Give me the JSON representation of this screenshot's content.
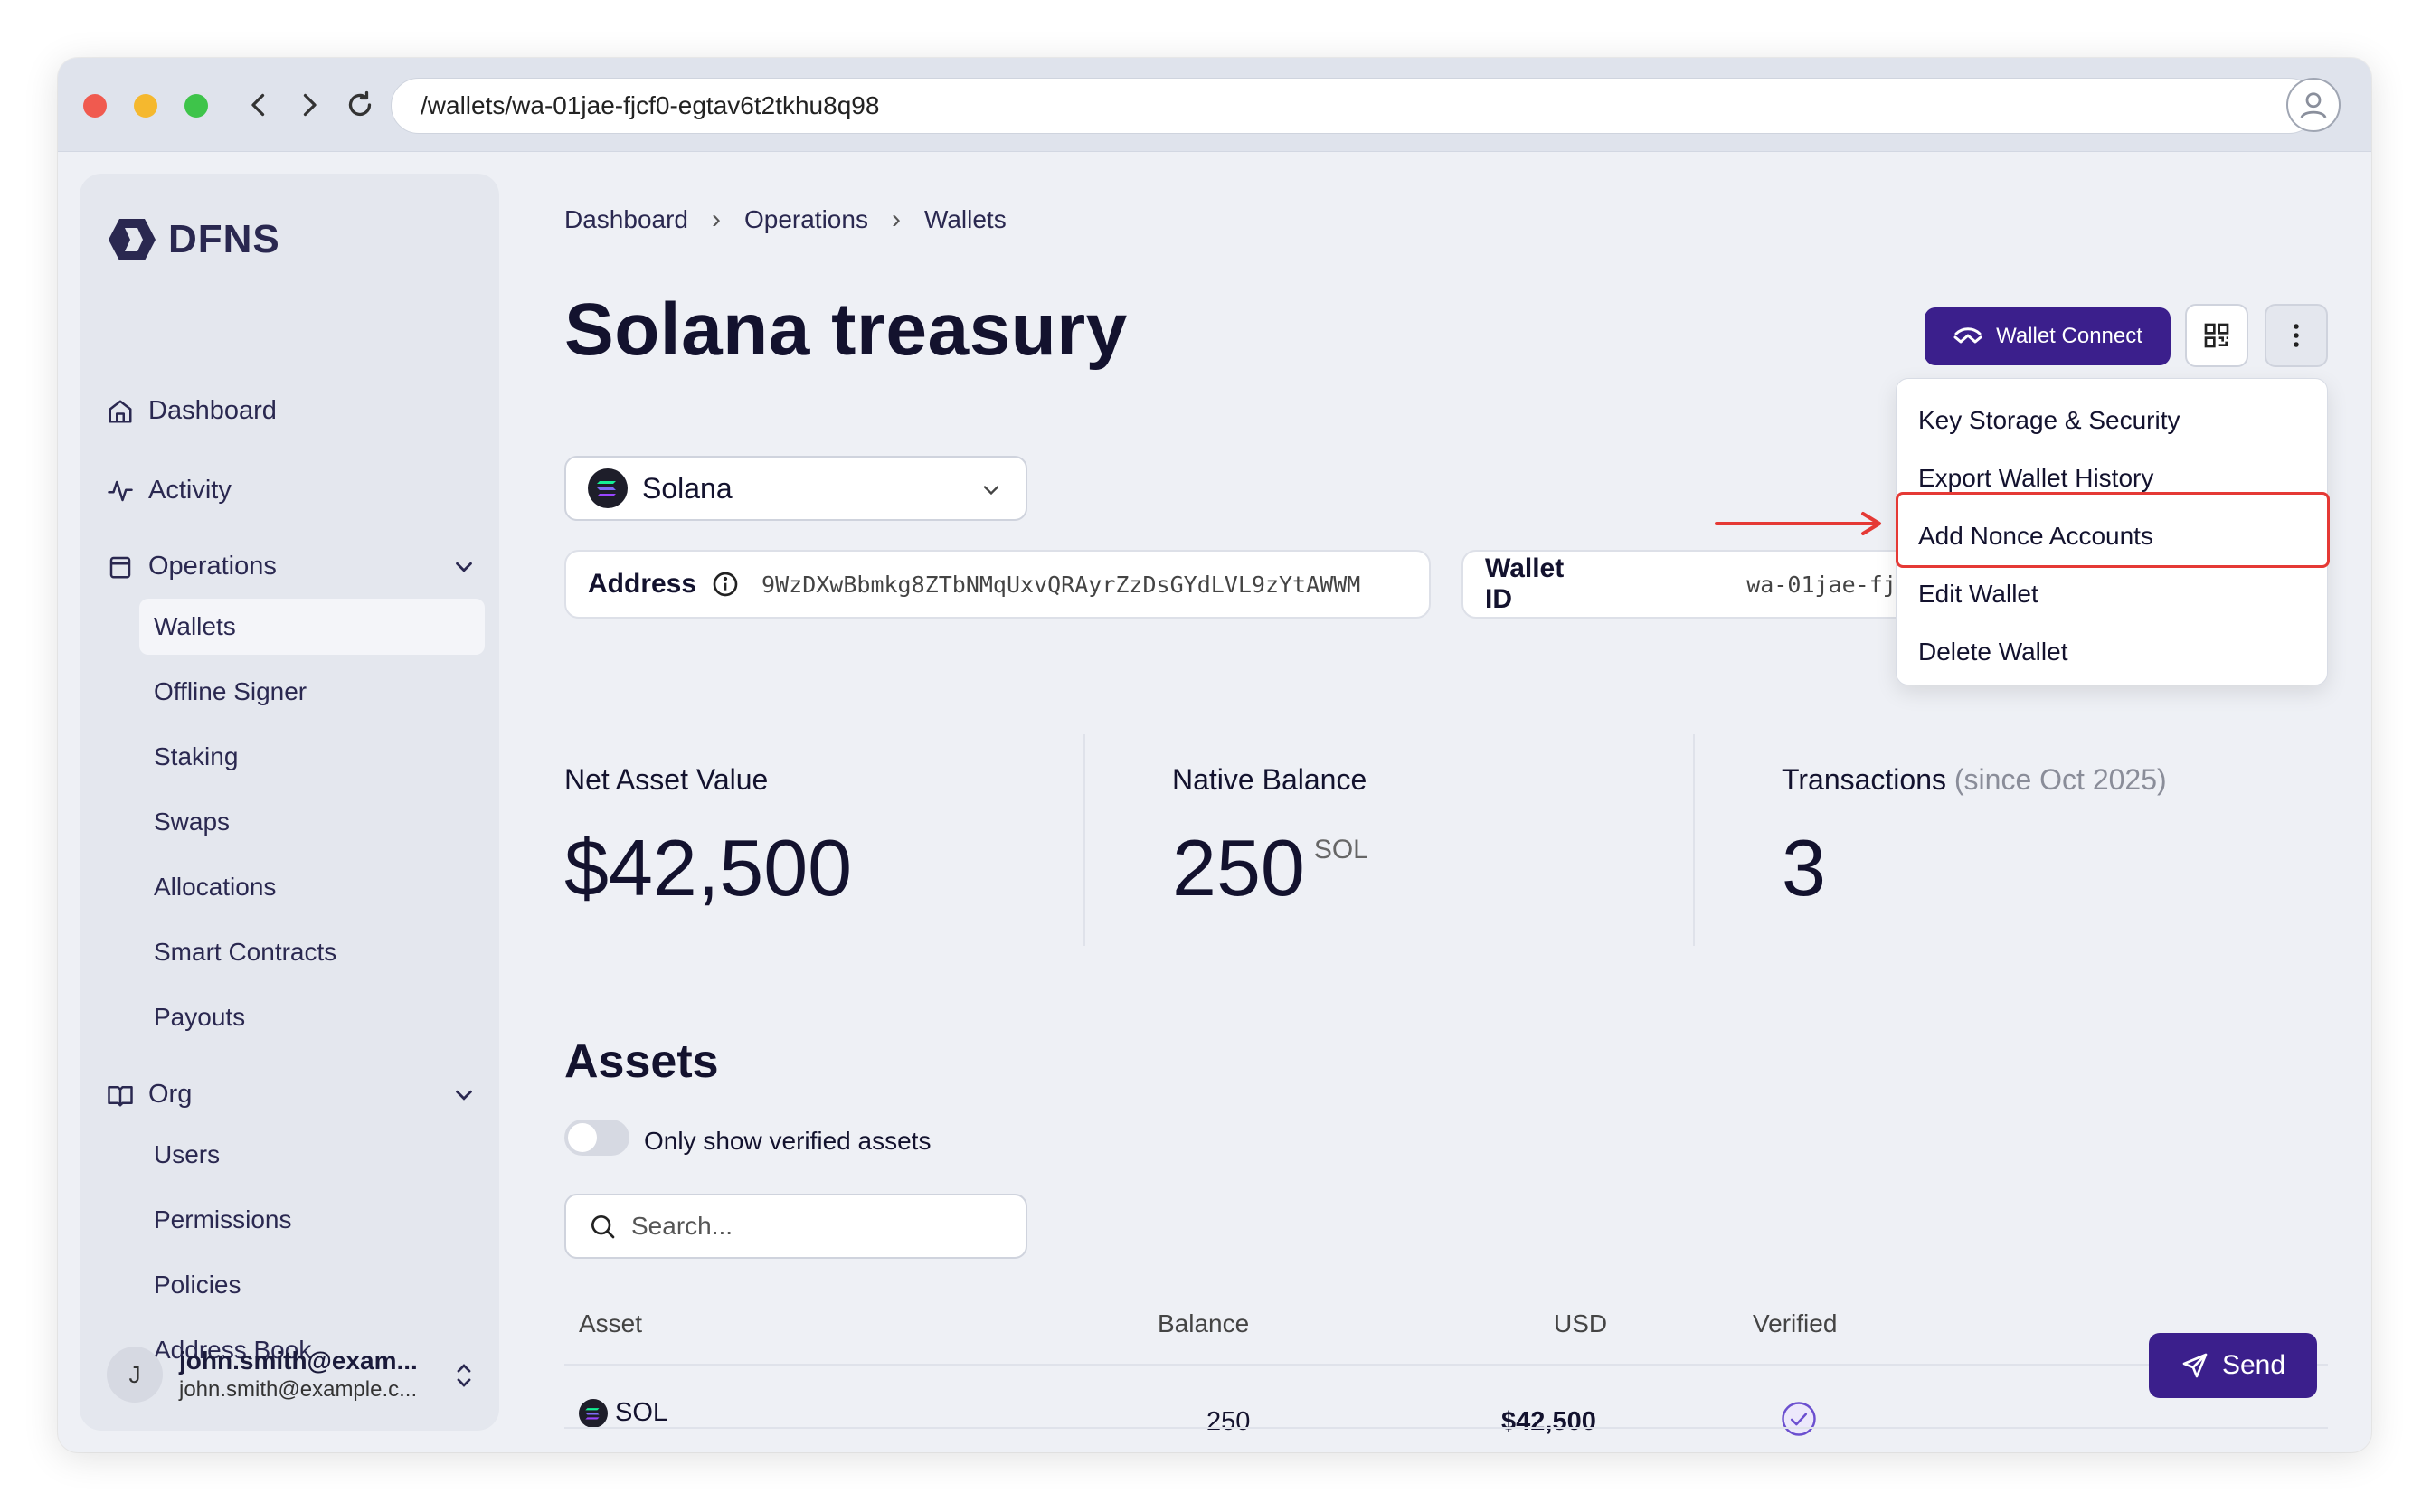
{
  "browser": {
    "url": "/wallets/wa-01jae-fjcf0-egtav6t2tkhu8q98"
  },
  "sidebar": {
    "logo": "DFNS",
    "items": [
      {
        "label": "Dashboard",
        "icon": "home-icon"
      },
      {
        "label": "Activity",
        "icon": "activity-icon"
      },
      {
        "label": "Operations",
        "icon": "clipboard-icon"
      },
      {
        "label": "Org",
        "icon": "book-icon"
      }
    ],
    "operations_sub": [
      "Wallets",
      "Offline Signer",
      "Staking",
      "Swaps",
      "Allocations",
      "Smart Contracts",
      "Payouts"
    ],
    "org_sub": [
      "Users",
      "Permissions",
      "Policies",
      "Address Book"
    ],
    "user": {
      "initial": "J",
      "name": "john.smith@exam...",
      "email": "john.smith@example.c..."
    }
  },
  "breadcrumb": [
    "Dashboard",
    "Operations",
    "Wallets"
  ],
  "page_title": "Solana treasury",
  "header_actions": {
    "wallet_connect_label": "Wallet Connect"
  },
  "menu": {
    "items": [
      "Key Storage & Security",
      "Export Wallet History",
      "Add Nonce Accounts",
      "Edit Wallet",
      "Delete Wallet"
    ],
    "highlighted": "Add Nonce Accounts"
  },
  "network_select": {
    "value": "Solana"
  },
  "address": {
    "label": "Address",
    "value": "9WzDXwBbmkg8ZTbNMqUxvQRAyrZzDsGYdLVL9zYtAWWM"
  },
  "wallet_id": {
    "label": "Wallet ID",
    "value": "wa-01jae-fjcf0-egtav6t2tkhu8q98"
  },
  "stats": {
    "net_asset_value": {
      "label": "Net Asset Value",
      "value": "$42,500"
    },
    "native_balance": {
      "label": "Native Balance",
      "value": "250",
      "unit": "SOL"
    },
    "transactions": {
      "label": "Transactions",
      "sublabel": "(since Oct 2025)",
      "value": "3"
    }
  },
  "assets": {
    "title": "Assets",
    "toggle_label": "Only show verified assets",
    "search_placeholder": "Search...",
    "columns": [
      "Asset",
      "Balance",
      "USD",
      "Verified"
    ],
    "rows": [
      {
        "asset": "SOL",
        "balance": "250",
        "usd": "$42,500",
        "verified": true,
        "action": "Send"
      }
    ]
  },
  "colors": {
    "primary": "#3b1f8c",
    "highlight": "#e53935",
    "background": "#eef0f5"
  }
}
